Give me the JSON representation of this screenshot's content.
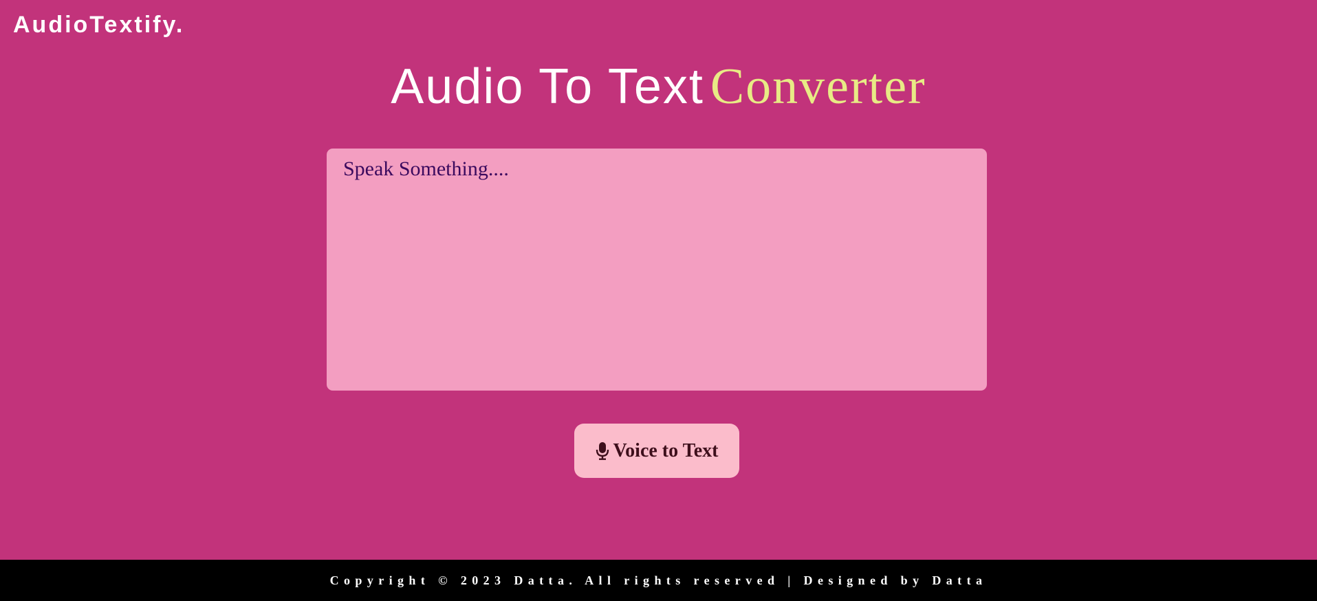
{
  "header": {
    "brand": "AudioTextify."
  },
  "main": {
    "title_main": "Audio To Text",
    "title_accent": "Converter",
    "speech_box": {
      "text": "Speak Something...."
    },
    "voice_button": {
      "icon": "microphone-icon",
      "label": "Voice to Text"
    }
  },
  "footer": {
    "text": "Copyright © 2023 Datta. All rights reserved | Designed by Datta"
  },
  "colors": {
    "background": "#c2337b",
    "accent": "#e8eb85",
    "speech_box": "#f39ec1",
    "button": "#fbbccb",
    "footer": "#000000"
  }
}
